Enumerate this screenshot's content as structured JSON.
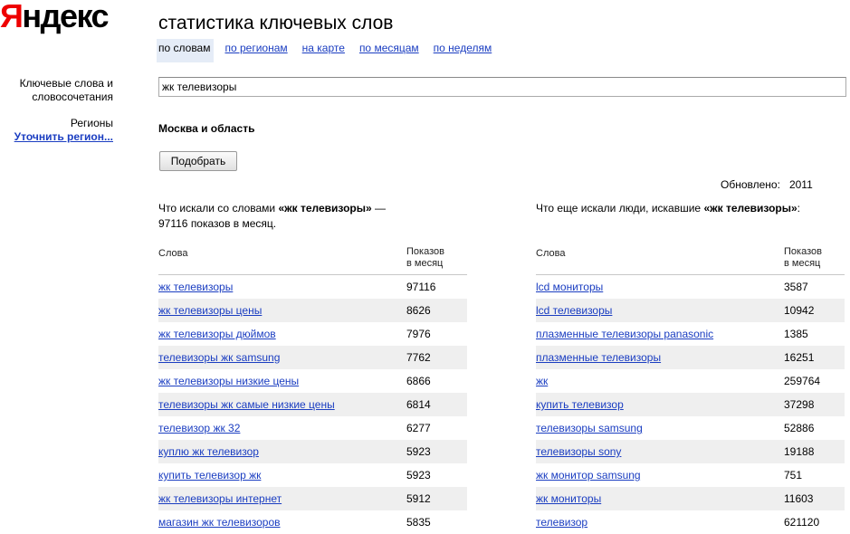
{
  "logo": {
    "first_letter": "Я",
    "rest": "ндекс"
  },
  "title": "статистика ключевых слов",
  "tabs": [
    {
      "label": "по словам",
      "active": true
    },
    {
      "label": "по регионам",
      "active": false
    },
    {
      "label": "на карте",
      "active": false
    },
    {
      "label": "по месяцам",
      "active": false
    },
    {
      "label": "по неделям",
      "active": false
    }
  ],
  "sidebar": {
    "keywords_line1": "Ключевые слова и",
    "keywords_line2": "словосочетания",
    "regions_label": "Регионы",
    "refine_region_link": "Уточнить регион..."
  },
  "search": {
    "value": "жк телевизоры"
  },
  "region": "Москва и область",
  "submit_label": "Подобрать",
  "updated": {
    "label": "Обновлено:",
    "value": "2011"
  },
  "left": {
    "desc_prefix": "Что искали со словами ",
    "desc_query": "«жк телевизоры»",
    "desc_suffix": " — 97116 показов в месяц.",
    "col_words": "Слова",
    "col_shows_line1": "Показов",
    "col_shows_line2": "в месяц",
    "rows": [
      {
        "word": "жк телевизоры",
        "count": "97116"
      },
      {
        "word": "жк телевизоры цены",
        "count": "8626"
      },
      {
        "word": "жк телевизоры дюймов",
        "count": "7976"
      },
      {
        "word": "телевизоры жк samsung",
        "count": "7762"
      },
      {
        "word": "жк телевизоры низкие цены",
        "count": "6866"
      },
      {
        "word": "телевизоры жк самые низкие цены",
        "count": "6814"
      },
      {
        "word": "телевизор жк 32",
        "count": "6277"
      },
      {
        "word": "куплю жк телевизор",
        "count": "5923"
      },
      {
        "word": "купить телевизор жк",
        "count": "5923"
      },
      {
        "word": "жк телевизоры интернет",
        "count": "5912"
      },
      {
        "word": "магазин жк телевизоров",
        "count": "5835"
      }
    ]
  },
  "right": {
    "desc_prefix": "Что еще искали люди, искавшие ",
    "desc_query": "«жк телевизоры»",
    "desc_suffix": ":",
    "col_words": "Слова",
    "col_shows_line1": "Показов",
    "col_shows_line2": "в месяц",
    "rows": [
      {
        "word": "lcd мониторы",
        "count": "3587"
      },
      {
        "word": "lcd телевизоры",
        "count": "10942"
      },
      {
        "word": "плазменные телевизоры panasonic",
        "count": "1385"
      },
      {
        "word": "плазменные телевизоры",
        "count": "16251"
      },
      {
        "word": "жк",
        "count": "259764"
      },
      {
        "word": "купить телевизор",
        "count": "37298"
      },
      {
        "word": "телевизоры samsung",
        "count": "52886"
      },
      {
        "word": "телевизоры sony",
        "count": "19188"
      },
      {
        "word": "жк монитор samsung",
        "count": "751"
      },
      {
        "word": "жк мониторы",
        "count": "11603"
      },
      {
        "word": "телевизор",
        "count": "621120"
      }
    ]
  }
}
